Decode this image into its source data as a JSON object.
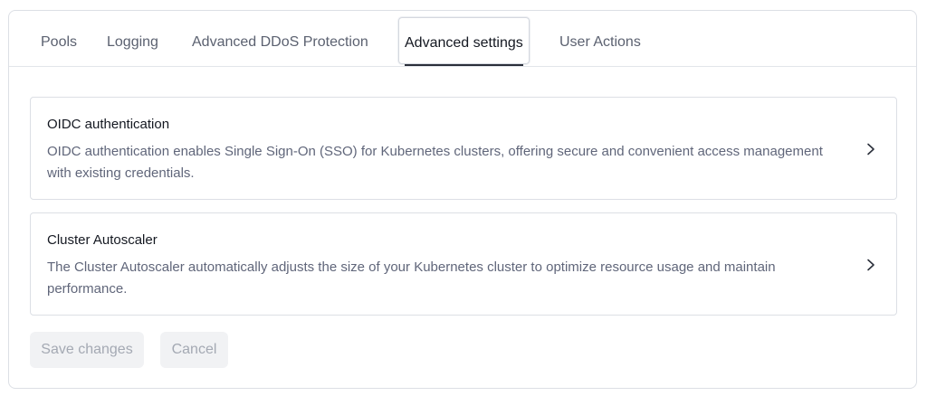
{
  "tabs": [
    {
      "label": "Pools"
    },
    {
      "label": "Logging"
    },
    {
      "label": "Advanced DDoS Protection"
    },
    {
      "label": "Advanced settings",
      "active": true
    },
    {
      "label": "User Actions"
    }
  ],
  "cards": [
    {
      "title": "OIDC authentication",
      "description": "OIDC authentication enables Single Sign-On (SSO) for Kubernetes clusters, offering secure and convenient access management with existing credentials.",
      "icon": "chevron-right-icon"
    },
    {
      "title": "Cluster Autoscaler",
      "description": "The Cluster Autoscaler automatically adjusts the size of your Kubernetes cluster to optimize resource usage and maintain performance.",
      "icon": "chevron-right-icon"
    }
  ],
  "actions": {
    "save_label": "Save changes",
    "cancel_label": "Cancel",
    "disabled": true
  },
  "colors": {
    "border": "#dcdfe5",
    "text_primary": "#141821",
    "text_secondary": "#60667a",
    "disabled_bg": "#f1f2f4",
    "disabled_text": "#a4a9b3"
  }
}
